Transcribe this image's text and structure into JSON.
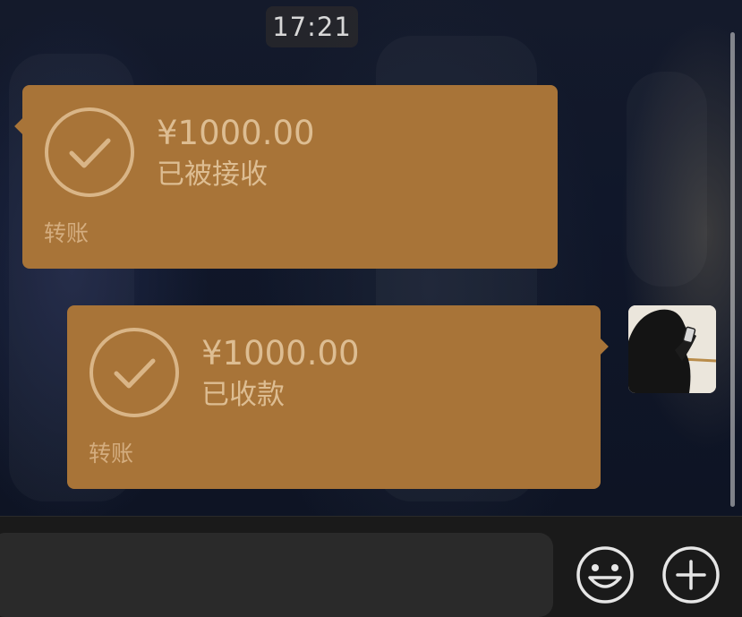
{
  "chat": {
    "timestamp": "17:21",
    "messages": [
      {
        "direction": "received",
        "type": "transfer",
        "amount": "¥1000.00",
        "status": "已被接收",
        "kind_label": "转账",
        "icon": "checkmark-circle-icon"
      },
      {
        "direction": "sent",
        "type": "transfer",
        "amount": "¥1000.00",
        "status": "已收款",
        "kind_label": "转账",
        "icon": "checkmark-circle-icon"
      }
    ]
  },
  "composer": {
    "input_value": "",
    "emoji_icon": "emoji-icon",
    "plus_icon": "plus-circle-icon"
  },
  "colors": {
    "transfer_bubble": "#a87438",
    "transfer_text": "#ddbd92",
    "input_bar": "#1a1a1a",
    "input_field": "#2a2a2a"
  }
}
